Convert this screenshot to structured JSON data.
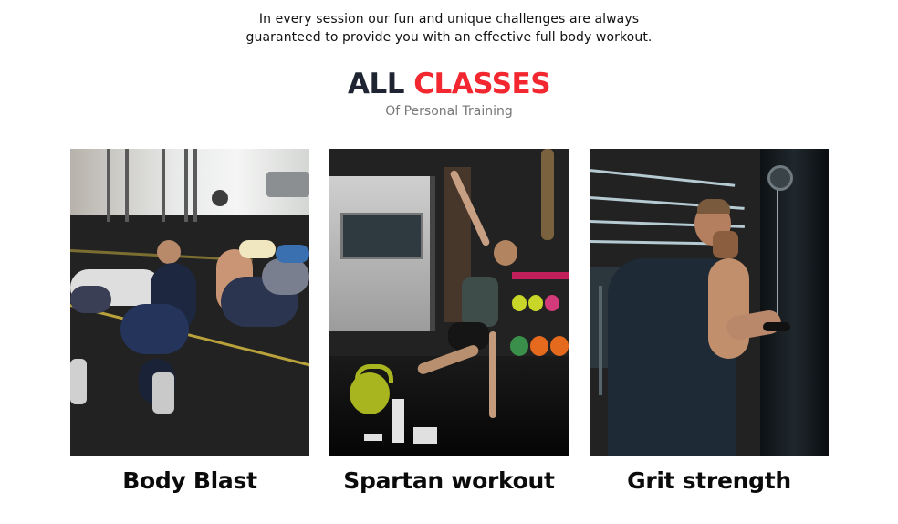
{
  "intro": {
    "line1": "In every session our fun and unique challenges are always",
    "line2": "guaranteed to provide you with an effective full body workout."
  },
  "heading": {
    "word1": "ALL",
    "word2": "CLASSES",
    "subtitle": "Of Personal Training"
  },
  "colors": {
    "heading_dark": "#1e2432",
    "heading_accent": "#f2272f",
    "subtitle": "#777777"
  },
  "classes": [
    {
      "name": "Body Blast",
      "image": "group-plank-photo"
    },
    {
      "name": "Spartan workout",
      "image": "side-plank-photo"
    },
    {
      "name": "Grit strength",
      "image": "cable-machine-photo"
    }
  ]
}
